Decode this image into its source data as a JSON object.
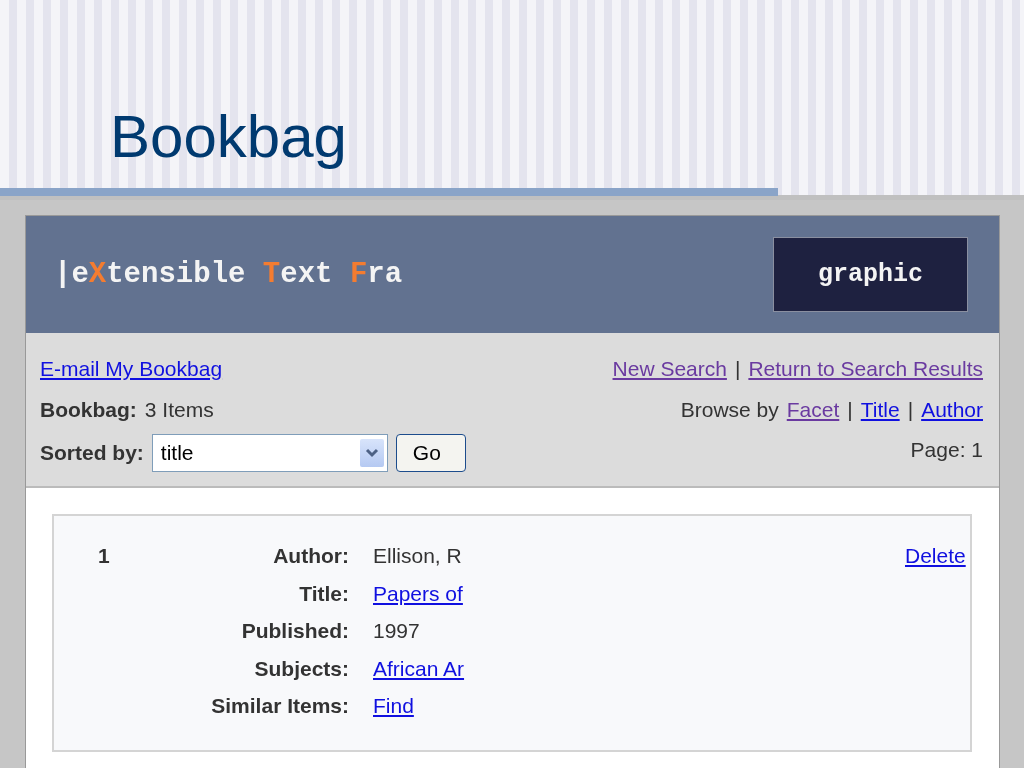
{
  "slide": {
    "title": "Bookbag"
  },
  "header": {
    "logo_segments": [
      {
        "text": "|e",
        "accent": false
      },
      {
        "text": "X",
        "accent": true
      },
      {
        "text": "tensible ",
        "accent": false
      },
      {
        "text": "T",
        "accent": true
      },
      {
        "text": "ext ",
        "accent": false
      },
      {
        "text": "F",
        "accent": true
      },
      {
        "text": "ra",
        "accent": false
      }
    ],
    "graphic_label": "graphic"
  },
  "toolbar": {
    "email_link": {
      "text": "E-mail My Bookbag",
      "visited": false
    },
    "bookbag_label": "Bookbag:",
    "bookbag_count": "3 Items",
    "sort_label": "Sorted by:",
    "sort_select": {
      "value": "title"
    },
    "go_button": "Go",
    "nav_rows": [
      [
        {
          "kind": "link",
          "text": "New Search",
          "visited": true
        },
        {
          "kind": "text",
          "text": "|"
        },
        {
          "kind": "link",
          "text": "Return to Search Results",
          "visited": true
        }
      ],
      [
        {
          "kind": "text",
          "text": "Browse by"
        },
        {
          "kind": "link",
          "text": "Facet",
          "visited": true
        },
        {
          "kind": "text",
          "text": "|"
        },
        {
          "kind": "link",
          "text": "Title",
          "visited": false
        },
        {
          "kind": "text",
          "text": "|"
        },
        {
          "kind": "link",
          "text": "Author",
          "visited": false
        }
      ],
      [
        {
          "kind": "text",
          "text": "Page: 1"
        }
      ]
    ]
  },
  "record": {
    "number": "1",
    "delete_link": "Delete",
    "fields": [
      {
        "label": "Author:",
        "kind": "text",
        "value": "Ellison, R"
      },
      {
        "label": "Title:",
        "kind": "link",
        "value": "Papers of",
        "visited": false
      },
      {
        "label": "Published:",
        "kind": "text",
        "value": "1997"
      },
      {
        "label": "Subjects:",
        "kind": "link",
        "value": "African Ar",
        "visited": false
      },
      {
        "label": "Similar Items:",
        "kind": "link",
        "value": "Find",
        "visited": false
      }
    ]
  }
}
